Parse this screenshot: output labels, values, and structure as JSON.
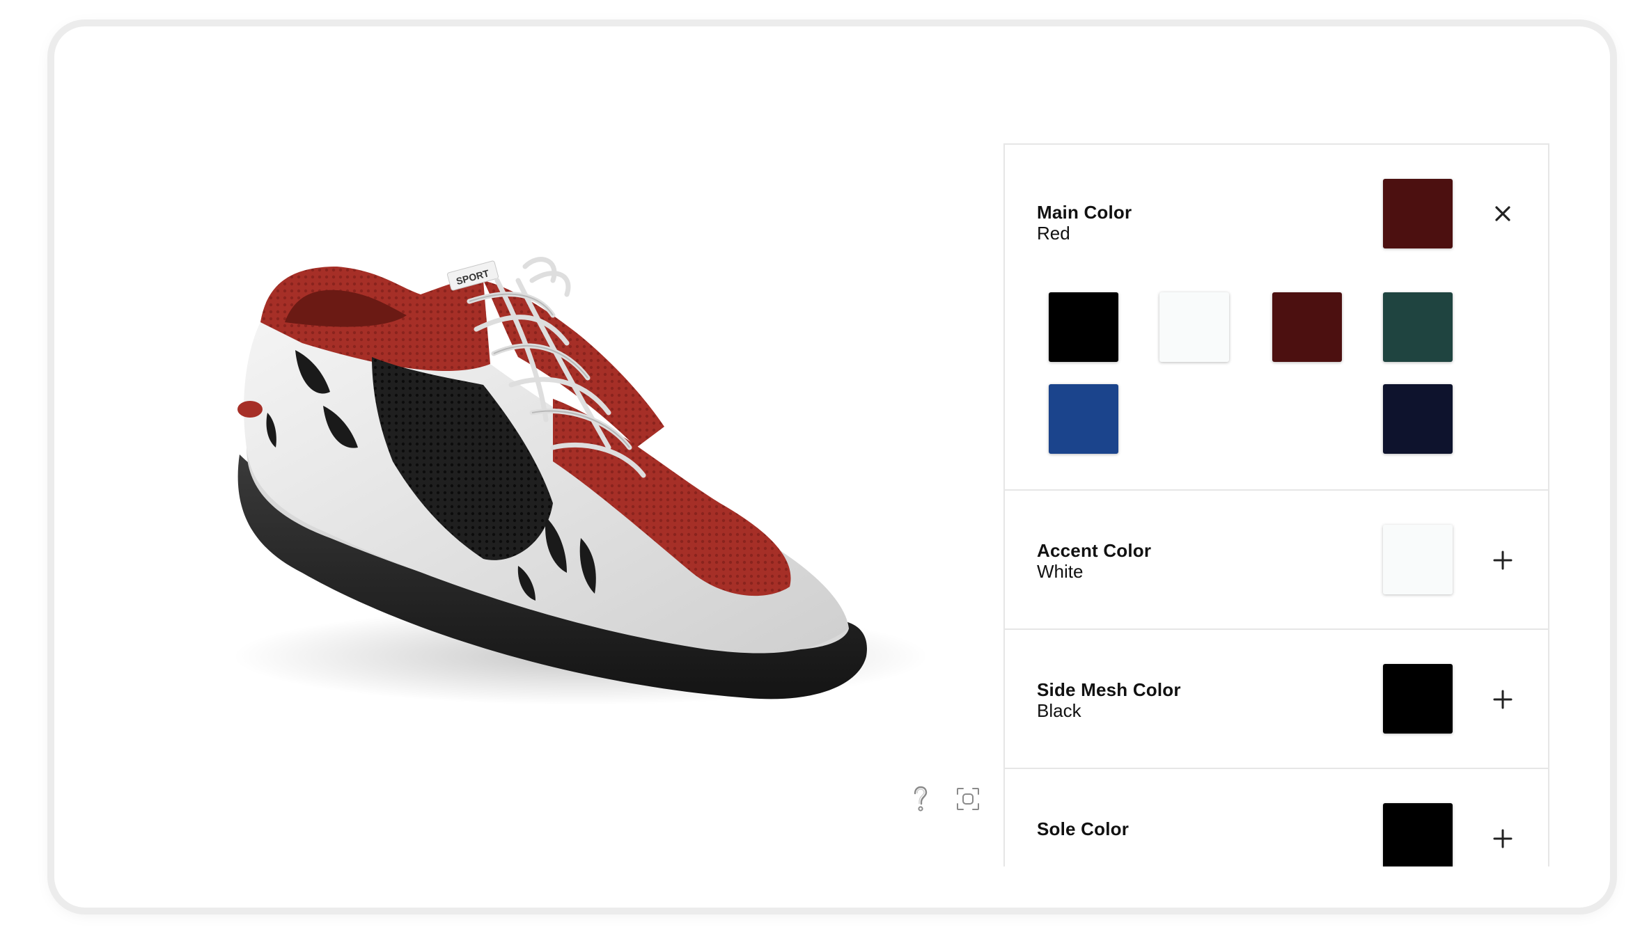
{
  "viewer": {
    "help_icon": "question-mark-icon",
    "fullscreen_icon": "fullscreen-icon"
  },
  "options": [
    {
      "title": "Main Color",
      "value": "Red",
      "color": "#4c1010",
      "expanded": true,
      "toggle_icon": "close-icon",
      "swatches": [
        {
          "name": "black",
          "color": "#000000"
        },
        {
          "name": "white",
          "color": "#f9fbfb"
        },
        {
          "name": "red",
          "color": "#4c1010"
        },
        {
          "name": "green",
          "color": "#1f4440"
        },
        {
          "name": "blue",
          "color": "#1b448c"
        },
        {
          "name": "navy",
          "color": "#0e132d"
        }
      ]
    },
    {
      "title": "Accent Color",
      "value": "White",
      "color": "#f9fbfb",
      "expanded": false,
      "toggle_icon": "plus-icon"
    },
    {
      "title": "Side Mesh Color",
      "value": "Black",
      "color": "#000000",
      "expanded": false,
      "toggle_icon": "plus-icon"
    },
    {
      "title": "Sole Color",
      "value": "",
      "color": "#000000",
      "expanded": false,
      "toggle_icon": "plus-icon"
    }
  ],
  "shoe": {
    "upper_color": "#a62f27",
    "accent_color": "#e9e9e9",
    "mesh_color": "#1a1a1a",
    "sole_color": "#222222",
    "tongue_label": "SPORT"
  }
}
